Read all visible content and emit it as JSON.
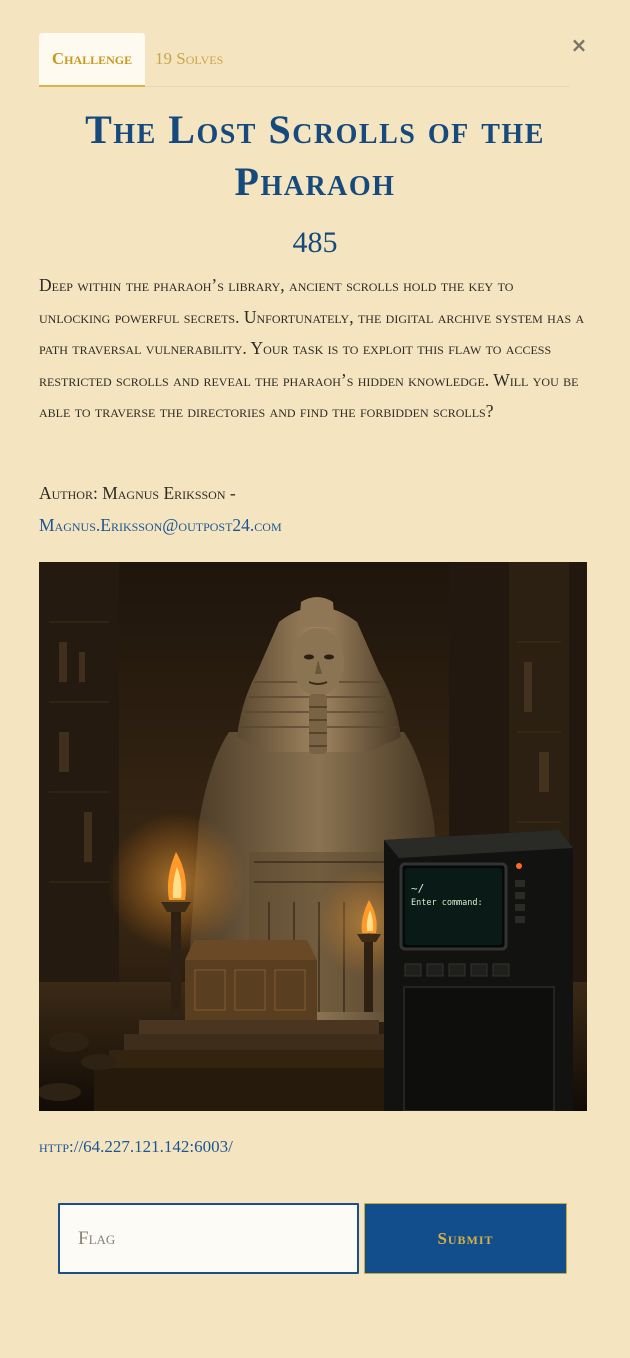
{
  "modal": {
    "close_icon": "close-icon",
    "close_glyph": "×"
  },
  "tabs": [
    {
      "label": "Challenge",
      "active": true
    },
    {
      "label": "19 Solves",
      "active": false
    }
  ],
  "challenge": {
    "title": "The Lost Scrolls of the Pharaoh",
    "points": "485",
    "description": "Deep within the pharaoh’s library, ancient scrolls hold the key to unlocking powerful secrets. Unfortunately, the digital archive system has a path traversal vulnerability. Your task is to exploit this flaw to access restricted scrolls and reveal the pharaoh’s hidden knowledge. Will you be able to traverse the directories and find the forbidden scrolls?",
    "author_label": "Author: Magnus Eriksson -",
    "author_email": "Magnus.Eriksson@outpost24.com",
    "terminal_prompt": "~/",
    "terminal_command": "Enter command:",
    "connection_url": "http://64.227.121.142:6003/"
  },
  "form": {
    "flag_placeholder": "Flag",
    "flag_value": "",
    "submit_label": "Submit"
  },
  "colors": {
    "background": "#f4e5c0",
    "accent_blue": "#164a7e",
    "accent_gold": "#c99a20",
    "link": "#1d5593",
    "submit_bg": "#124e8b"
  }
}
